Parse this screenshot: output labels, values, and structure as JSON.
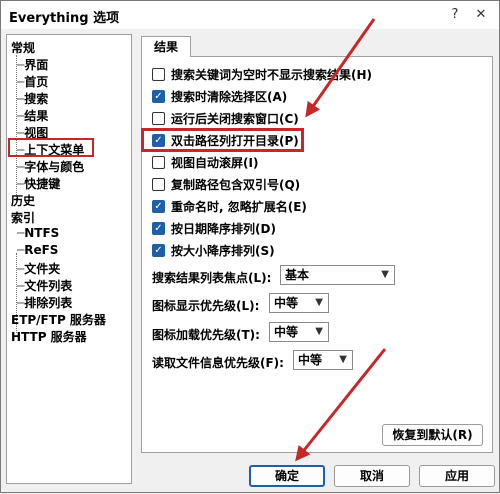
{
  "window": {
    "title": "Everything 选项",
    "help_glyph": "?",
    "close_glyph": "✕"
  },
  "tree": {
    "groups": [
      {
        "label": "常规",
        "children": [
          "界面",
          "首页",
          "搜索",
          "结果",
          "视图",
          "上下文菜单",
          "字体与颜色",
          "快捷键"
        ],
        "selected": "结果"
      },
      {
        "label": "历史",
        "children": []
      },
      {
        "label": "索引",
        "children": [
          "NTFS",
          "ReFS",
          "文件夹",
          "文件列表",
          "排除列表"
        ]
      },
      {
        "label": "ETP/FTP 服务器",
        "children": []
      },
      {
        "label": "HTTP 服务器",
        "children": []
      }
    ]
  },
  "tab": {
    "label": "结果"
  },
  "options": [
    {
      "label": "搜索关键词为空时不显示搜索结果(H)",
      "checked": false
    },
    {
      "label": "搜索时清除选择区(A)",
      "checked": true
    },
    {
      "label": "运行后关闭搜索窗口(C)",
      "checked": false
    },
    {
      "label": "双击路径列打开目录(P)",
      "checked": true
    },
    {
      "label": "视图自动滚屏(I)",
      "checked": false
    },
    {
      "label": "复制路径包含双引号(Q)",
      "checked": false
    },
    {
      "label": "重命名时, 忽略扩展名(E)",
      "checked": true
    },
    {
      "label": "按日期降序排列(D)",
      "checked": true
    },
    {
      "label": "按大小降序排列(S)",
      "checked": true
    }
  ],
  "fields": [
    {
      "label": "搜索结果列表焦点(L):",
      "value": "基本"
    },
    {
      "label": "图标显示优先级(L):",
      "value": "中等"
    },
    {
      "label": "图标加载优先级(T):",
      "value": "中等"
    },
    {
      "label": "读取文件信息优先级(F):",
      "value": "中等"
    }
  ],
  "buttons": {
    "restore": "恢复到默认(R)",
    "ok": "确定",
    "cancel": "取消",
    "apply": "应用"
  },
  "colors": {
    "annotation": "#c62828",
    "checkbox": "#1f5fa8"
  }
}
